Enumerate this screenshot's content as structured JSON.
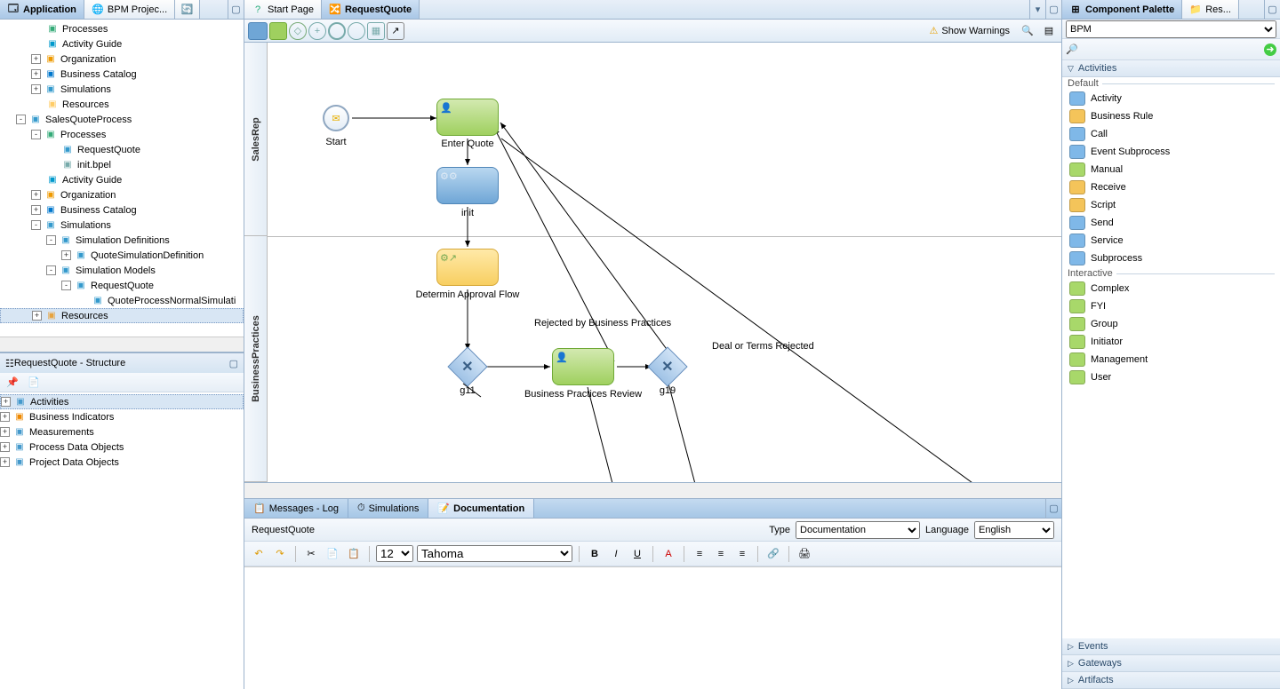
{
  "leftTabs": {
    "application": "Application",
    "bpm": "BPM Projec...",
    "min": "–"
  },
  "navTree": [
    {
      "ind": 1,
      "tog": "",
      "ico": "📄",
      "c": "#3a7",
      "label": "Processes"
    },
    {
      "ind": 1,
      "tog": "",
      "ico": "📘",
      "c": "#09c",
      "label": "Activity Guide"
    },
    {
      "ind": 1,
      "tog": "+",
      "ico": "�org",
      "c": "#e90",
      "label": "Organization"
    },
    {
      "ind": 1,
      "tog": "+",
      "ico": "📚",
      "c": "#07c",
      "label": "Business Catalog"
    },
    {
      "ind": 1,
      "tog": "+",
      "ico": "⏱",
      "c": "#39c",
      "label": "Simulations"
    },
    {
      "ind": 1,
      "tog": "",
      "ico": "📁",
      "c": "#fc6",
      "label": "Resources"
    },
    {
      "ind": 0,
      "tog": "-",
      "ico": "📦",
      "c": "#39c",
      "label": "SalesQuoteProcess"
    },
    {
      "ind": 1,
      "tog": "-",
      "ico": "📄",
      "c": "#3a7",
      "label": "Processes"
    },
    {
      "ind": 2,
      "tog": "",
      "ico": "🔀",
      "c": "#39c",
      "label": "RequestQuote"
    },
    {
      "ind": 2,
      "tog": "",
      "ico": "📄",
      "c": "#7aa",
      "label": "init.bpel"
    },
    {
      "ind": 1,
      "tog": "",
      "ico": "📘",
      "c": "#09c",
      "label": "Activity Guide"
    },
    {
      "ind": 1,
      "tog": "+",
      "ico": "�org",
      "c": "#e90",
      "label": "Organization"
    },
    {
      "ind": 1,
      "tog": "+",
      "ico": "📚",
      "c": "#07c",
      "label": "Business Catalog"
    },
    {
      "ind": 1,
      "tog": "-",
      "ico": "⏱",
      "c": "#39c",
      "label": "Simulations"
    },
    {
      "ind": 2,
      "tog": "-",
      "ico": "📑",
      "c": "#39c",
      "label": "Simulation Definitions"
    },
    {
      "ind": 3,
      "tog": "+",
      "ico": "📄",
      "c": "#39c",
      "label": "QuoteSimulationDefinition"
    },
    {
      "ind": 2,
      "tog": "-",
      "ico": "📑",
      "c": "#39c",
      "label": "Simulation Models"
    },
    {
      "ind": 3,
      "tog": "-",
      "ico": "🔀",
      "c": "#39c",
      "label": "RequestQuote"
    },
    {
      "ind": 4,
      "tog": "",
      "ico": "📄",
      "c": "#39c",
      "label": "QuoteProcessNormalSimulati"
    },
    {
      "ind": 1,
      "tog": "+",
      "ico": "📁",
      "c": "#e7a33e",
      "label": "Resources",
      "sel": true
    }
  ],
  "structHead": "RequestQuote - Structure",
  "structTree": [
    {
      "tog": "+",
      "ico": "📋",
      "c": "#49c",
      "label": "Activities",
      "sel": true
    },
    {
      "tog": "+",
      "ico": "📊",
      "c": "#e80",
      "label": "Business Indicators"
    },
    {
      "tog": "+",
      "ico": "📏",
      "c": "#49c",
      "label": "Measurements"
    },
    {
      "tog": "+",
      "ico": "🗃",
      "c": "#49c",
      "label": "Process Data Objects"
    },
    {
      "tog": "+",
      "ico": "🗃",
      "c": "#49c",
      "label": "Project Data Objects"
    }
  ],
  "editorTabs": {
    "start": "Start Page",
    "rq": "RequestQuote"
  },
  "edToolbar": {
    "warn": "Show Warnings"
  },
  "lanes": {
    "top": "SalesRep",
    "bottom": "BusinessPractices"
  },
  "nodes": {
    "start": "Start",
    "enter": "Enter Quote",
    "init": "init",
    "det": "Determin Approval Flow",
    "g11": "g11",
    "bpr": "Business Practices Review",
    "g19": "g19"
  },
  "edges": {
    "rej": "Rejected by Business Practices",
    "deal": "Deal or Terms Rejected"
  },
  "bottomTabs": {
    "msg": "Messages - Log",
    "sim": "Simulations",
    "doc": "Documentation"
  },
  "doc": {
    "title": "RequestQuote",
    "typeLbl": "Type",
    "type": "Documentation",
    "langLbl": "Language",
    "lang": "English",
    "fontSize": "12",
    "font": "Tahoma"
  },
  "rightTabs": {
    "pal": "Component Palette",
    "res": "Res..."
  },
  "palSelect": "BPM",
  "palSections": {
    "act": "Activities",
    "ev": "Events",
    "gw": "Gateways",
    "art": "Artifacts"
  },
  "palGroups": {
    "def": "Default",
    "int": "Interactive"
  },
  "palDefault": [
    {
      "c": "#7fb8e8",
      "t": "Activity"
    },
    {
      "c": "#f4c45a",
      "t": "Business Rule"
    },
    {
      "c": "#7fb8e8",
      "t": "Call"
    },
    {
      "c": "#7fb8e8",
      "t": "Event Subprocess"
    },
    {
      "c": "#a8d86a",
      "t": "Manual"
    },
    {
      "c": "#f4c45a",
      "t": "Receive"
    },
    {
      "c": "#f4c45a",
      "t": "Script"
    },
    {
      "c": "#7fb8e8",
      "t": "Send"
    },
    {
      "c": "#7fb8e8",
      "t": "Service"
    },
    {
      "c": "#7fb8e8",
      "t": "Subprocess"
    }
  ],
  "palInteractive": [
    {
      "c": "#a8d86a",
      "t": "Complex"
    },
    {
      "c": "#a8d86a",
      "t": "FYI"
    },
    {
      "c": "#a8d86a",
      "t": "Group"
    },
    {
      "c": "#a8d86a",
      "t": "Initiator"
    },
    {
      "c": "#a8d86a",
      "t": "Management"
    },
    {
      "c": "#a8d86a",
      "t": "User"
    }
  ]
}
